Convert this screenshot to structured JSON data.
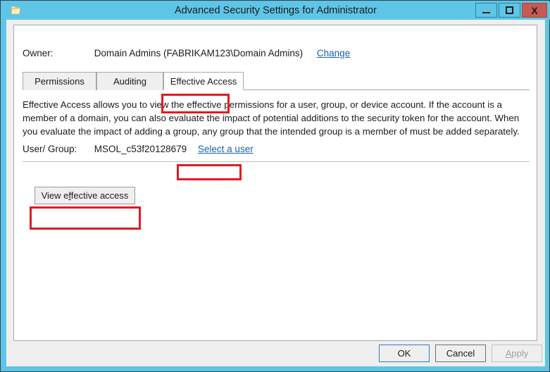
{
  "window": {
    "title": "Advanced Security Settings for Administrator",
    "icon": "folder-icon",
    "controls": {
      "minimize": "minimize-icon",
      "maximize": "maximize-icon",
      "close": "X"
    },
    "frame_color": "#5dc6e8",
    "close_color": "#c75b54"
  },
  "owner": {
    "label": "Owner:",
    "value": "Domain Admins (FABRIKAM123\\Domain Admins)",
    "change_link": "Change"
  },
  "tabs": [
    {
      "label": "Permissions",
      "active": false
    },
    {
      "label": "Auditing",
      "active": false
    },
    {
      "label": "Effective Access",
      "active": true
    }
  ],
  "description": "Effective Access allows you to view the effective permissions for a user, group, or device account. If the account is a member of a domain, you can also evaluate the impact of potential additions to the security token for the account. When you evaluate the impact of adding a group, any group that the intended group is a member of must be added separately.",
  "user_group": {
    "label": "User/ Group:",
    "value": "MSOL_c53f20128679",
    "select_link_pre": "Select a ",
    "select_link_accel": "u",
    "select_link_post": "ser"
  },
  "view_effective_access_button": {
    "pre": "View e",
    "accel": "f",
    "post": "fective access"
  },
  "footer": {
    "ok": "OK",
    "cancel": "Cancel",
    "apply_accel": "A",
    "apply_post": "pply"
  },
  "annotations": {
    "color": "#e01b22",
    "boxes": [
      "effective-access-tab",
      "select-a-user-link",
      "view-effective-access-button"
    ]
  }
}
